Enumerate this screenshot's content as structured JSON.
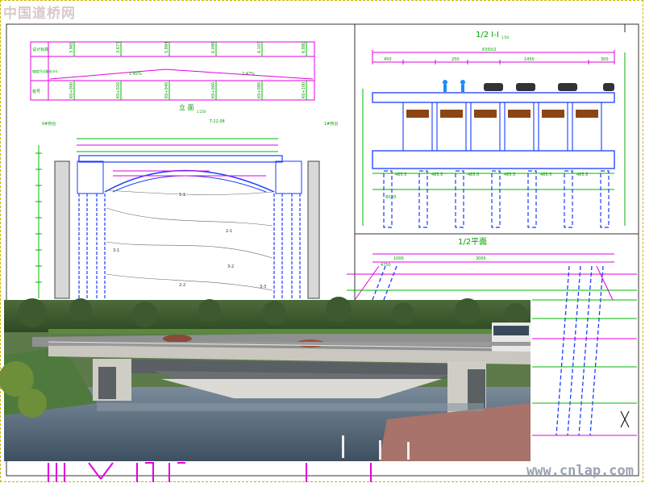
{
  "watermark_top": "中国道桥网",
  "watermark_bottom": "www.cnlap.com",
  "elevation_view": {
    "title": "立 面",
    "scale": "1:250",
    "table": {
      "rows": [
        "设计标高",
        "坡度(%)/坡长(m)",
        "桩号"
      ],
      "design_elevations": [
        "3.981",
        "3.673",
        "5.884",
        "6.096",
        "6.107",
        "6.880"
      ],
      "grade": [
        "1.45%",
        "2.47%"
      ],
      "stations": [
        "K0+000",
        "K0+020",
        "K0+040",
        "K0+060",
        "K0+080",
        "K0+100"
      ]
    },
    "layers": [
      "1-1",
      "2-1",
      "2-2",
      "3-1",
      "3-2",
      "3-3"
    ],
    "left_pier_label": "0#桥台",
    "right_pier_label": "1#桥台",
    "span_label": "T-22.08"
  },
  "cross_section": {
    "title": "1/2 I-I",
    "scale": "1:50",
    "total_width": "6350/2",
    "segments": [
      "450",
      "250",
      "1450",
      "300"
    ],
    "pile_spacing": [
      "485.5",
      "485.5",
      "485.5",
      "485.5",
      "485.5",
      "485.5"
    ],
    "pile_diameter": "Φ120"
  },
  "plan_view": {
    "title": "1/2平面",
    "dims": [
      "4750",
      "1000",
      "3000"
    ]
  },
  "rendering": {
    "caption": "桥梁效果图"
  },
  "colors": {
    "magenta": "#e000e0",
    "green": "#00b800",
    "blue": "#1a3cff",
    "darkred": "#7a1a1a"
  }
}
